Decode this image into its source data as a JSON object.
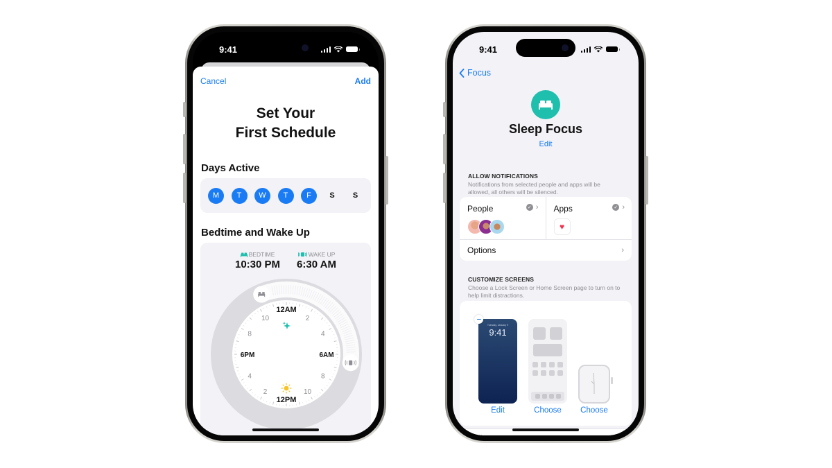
{
  "left_phone": {
    "status_time": "9:41",
    "nav": {
      "cancel_label": "Cancel",
      "add_label": "Add"
    },
    "title_line1": "Set Your",
    "title_line2": "First Schedule",
    "days_section_title": "Days Active",
    "days": [
      {
        "label": "M",
        "active": true
      },
      {
        "label": "T",
        "active": true
      },
      {
        "label": "W",
        "active": true
      },
      {
        "label": "T",
        "active": true
      },
      {
        "label": "F",
        "active": true
      },
      {
        "label": "S",
        "active": false
      },
      {
        "label": "S",
        "active": false
      }
    ],
    "bedtime_section_title": "Bedtime and Wake Up",
    "bedtime": {
      "label": "BEDTIME",
      "value": "10:30 PM",
      "icon": "bed-icon"
    },
    "wakeup": {
      "label": "WAKE UP",
      "value": "6:30 AM",
      "icon": "alarm-icon"
    },
    "clock": {
      "labels_major": {
        "top": "12AM",
        "right": "6AM",
        "bottom": "12PM",
        "left": "6PM"
      },
      "labels_minor": [
        "2",
        "4",
        "8",
        "10",
        "8",
        "4",
        "2",
        "10"
      ],
      "night_icon": "sparkles-icon",
      "day_icon": "sun-icon",
      "colors": {
        "accent_teal": "#1fbfae",
        "sun": "#f7c325"
      }
    }
  },
  "right_phone": {
    "status_time": "9:41",
    "back_label": "Focus",
    "focus_icon": "bed-icon",
    "title": "Sleep Focus",
    "edit_label": "Edit",
    "allow_notifications": {
      "header": "ALLOW NOTIFICATIONS",
      "description": "Notifications from selected people and apps will be allowed, all others will be silenced.",
      "people_label": "People",
      "apps_label": "Apps",
      "options_label": "Options"
    },
    "customize_screens": {
      "header": "CUSTOMIZE SCREENS",
      "description": "Choose a Lock Screen or Home Screen page to turn on to help limit distractions.",
      "lock_screen_time": "9:41",
      "lock_screen_date": "Tuesday, January 9",
      "labels": [
        "Edit",
        "Choose",
        "Choose"
      ]
    },
    "options_peek_label": "Options"
  },
  "colors": {
    "ios_blue": "#1a7cf5",
    "focus_teal": "#1fbfae",
    "grouped_bg": "#f2f2f7"
  }
}
